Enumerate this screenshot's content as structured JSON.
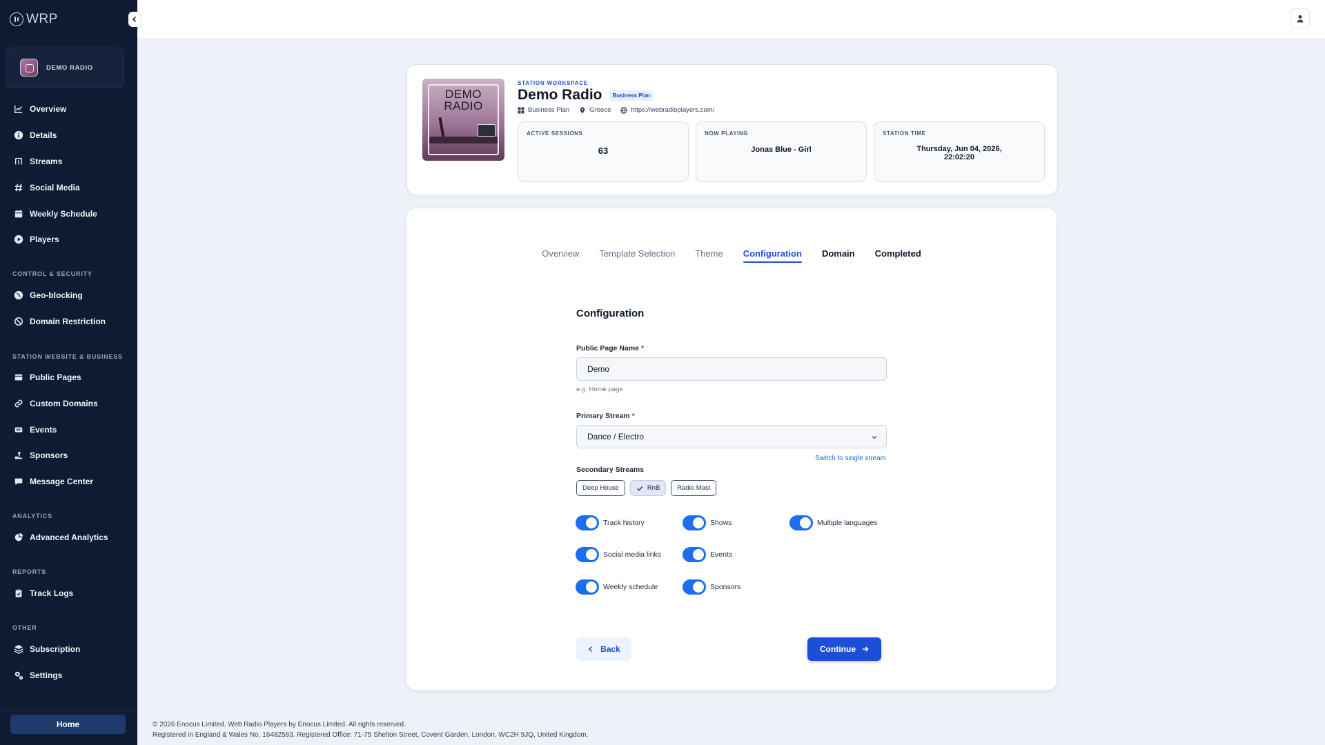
{
  "app": {
    "logo_text": "WRP"
  },
  "sidebar": {
    "station_name": "DEMO RADIO",
    "items": [
      {
        "label": "Overview",
        "icon": "chart-line-icon"
      },
      {
        "label": "Details",
        "icon": "info-icon"
      },
      {
        "label": "Streams",
        "icon": "antenna-icon"
      },
      {
        "label": "Social Media",
        "icon": "hashtag-icon"
      },
      {
        "label": "Weekly Schedule",
        "icon": "calendar-icon"
      },
      {
        "label": "Players",
        "icon": "play-icon"
      }
    ],
    "sections": {
      "control": "CONTROL & SECURITY",
      "website": "STATION WEBSITE & BUSINESS",
      "analytics": "ANALYTICS",
      "reports": "REPORTS",
      "other": "OTHER"
    },
    "control_items": [
      {
        "label": "Geo-blocking",
        "icon": "globe-icon"
      },
      {
        "label": "Domain Restriction",
        "icon": "ban-icon"
      }
    ],
    "website_items": [
      {
        "label": "Public Pages",
        "icon": "page-icon"
      },
      {
        "label": "Custom Domains",
        "icon": "link-icon"
      },
      {
        "label": "Events",
        "icon": "ticket-icon"
      },
      {
        "label": "Sponsors",
        "icon": "hand-icon"
      },
      {
        "label": "Message Center",
        "icon": "message-icon"
      }
    ],
    "analytics_items": [
      {
        "label": "Advanced Analytics",
        "icon": "pie-chart-icon"
      }
    ],
    "reports_items": [
      {
        "label": "Track Logs",
        "icon": "clipboard-icon"
      }
    ],
    "other_items": [
      {
        "label": "Subscription",
        "icon": "layers-icon"
      },
      {
        "label": "Settings",
        "icon": "gears-icon"
      }
    ],
    "home_label": "Home"
  },
  "header": {
    "eyebrow": "STATION WORKSPACE",
    "title": "Demo Radio",
    "plan_badge": "Business Plan",
    "cover_text": "DEMO RADIO",
    "meta": {
      "plan": "Business Plan",
      "country": "Greece",
      "url": "https://webradioplayers.com/"
    },
    "stats": [
      {
        "label": "ACTIVE SESSIONS",
        "value": "63"
      },
      {
        "label": "NOW PLAYING",
        "value": "Jonas Blue - Girl"
      },
      {
        "label": "STATION TIME",
        "value_line1": "Thursday, Jun 04, 2026,",
        "value_line2": "22:02:20"
      }
    ]
  },
  "wizard": {
    "tabs": [
      "Overview",
      "Template Selection",
      "Theme",
      "Configuration",
      "Domain",
      "Completed"
    ],
    "active_tab": "Configuration",
    "title": "Configuration",
    "public_page_name": {
      "label": "Public Page Name",
      "required": "*",
      "value": "Demo",
      "helper": "e.g. Home page"
    },
    "primary_stream": {
      "label": "Primary Stream",
      "required": "*",
      "value": "Dance / Electro",
      "link": "Switch to single stream"
    },
    "secondary_streams": {
      "label": "Secondary Streams",
      "chips": [
        {
          "label": "Deep House",
          "selected": false
        },
        {
          "label": "RnB",
          "selected": true
        },
        {
          "label": "Radio Mast",
          "selected": false
        }
      ]
    },
    "toggles": [
      {
        "label": "Track history",
        "on": true
      },
      {
        "label": "Shows",
        "on": true
      },
      {
        "label": "Multiple languages",
        "on": true
      },
      {
        "label": "Social media links",
        "on": true
      },
      {
        "label": "Events",
        "on": true
      },
      {
        "label": "Weekly schedule",
        "on": true
      },
      {
        "label": "Sponsors",
        "on": true
      }
    ],
    "back_label": "Back",
    "continue_label": "Continue"
  },
  "footer": {
    "line1": "© 2026 Enocus Limited. Web Radio Players by Enocus Limited. All rights reserved.",
    "line2": "Registered in England & Wales No. 16482583. Registered Office: 71-75 Shelton Street, Covent Garden, London, WC2H 9JQ, United Kingdom."
  },
  "colors": {
    "sidebar": "#0f1b33",
    "accent": "#1d4ed8",
    "toggle": "#1d6df0"
  }
}
